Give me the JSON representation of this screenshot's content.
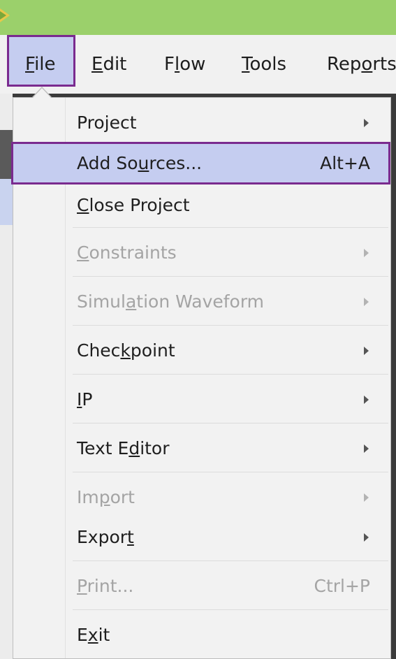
{
  "menubar": {
    "items": [
      {
        "pre": "",
        "u": "F",
        "post": "ile"
      },
      {
        "pre": "",
        "u": "E",
        "post": "dit"
      },
      {
        "pre": "F",
        "u": "l",
        "post": "ow"
      },
      {
        "pre": "",
        "u": "T",
        "post": "ools"
      },
      {
        "pre": "Rep",
        "u": "o",
        "post": "rts"
      }
    ]
  },
  "file_menu": {
    "items": [
      {
        "pre": "Pro",
        "u": "j",
        "post": "ect",
        "shortcut": "",
        "submenu": true,
        "enabled": true
      },
      {
        "pre": "Add So",
        "u": "u",
        "post": "rces...",
        "shortcut": "Alt+A",
        "submenu": false,
        "enabled": true,
        "highlighted": true
      },
      {
        "pre": "",
        "u": "C",
        "post": "lose Project",
        "shortcut": "",
        "submenu": false,
        "enabled": true
      },
      {
        "pre": "",
        "u": "C",
        "post": "onstraints",
        "shortcut": "",
        "submenu": true,
        "enabled": false
      },
      {
        "pre": "Simul",
        "u": "a",
        "post": "tion Waveform",
        "shortcut": "",
        "submenu": true,
        "enabled": false
      },
      {
        "pre": "Chec",
        "u": "k",
        "post": "point",
        "shortcut": "",
        "submenu": true,
        "enabled": true
      },
      {
        "pre": "",
        "u": "I",
        "post": "P",
        "shortcut": "",
        "submenu": true,
        "enabled": true
      },
      {
        "pre": "Text E",
        "u": "d",
        "post": "itor",
        "shortcut": "",
        "submenu": true,
        "enabled": true
      },
      {
        "pre": "Im",
        "u": "p",
        "post": "ort",
        "shortcut": "",
        "submenu": true,
        "enabled": false
      },
      {
        "pre": "Expor",
        "u": "t",
        "post": "",
        "shortcut": "",
        "submenu": true,
        "enabled": true
      },
      {
        "pre": "",
        "u": "P",
        "post": "rint...",
        "shortcut": "Ctrl+P",
        "submenu": false,
        "enabled": false
      },
      {
        "pre": "E",
        "u": "x",
        "post": "it",
        "shortcut": "",
        "submenu": false,
        "enabled": true
      }
    ]
  },
  "colors": {
    "titlebar": "#9bd06b",
    "highlight": "#c5cdf0",
    "highlight_border": "#7a2b8f",
    "disabled_text": "#a4a4a4"
  }
}
